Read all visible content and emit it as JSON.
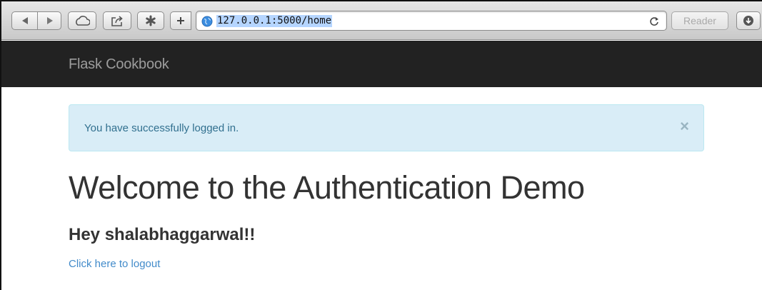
{
  "browser": {
    "url": "127.0.0.1:5000/home",
    "reader_label": "Reader",
    "icons": [
      "back-icon",
      "forward-icon",
      "cloud-icon",
      "share-icon",
      "bookmarks-icon",
      "new-tab-icon",
      "globe-icon",
      "reload-icon",
      "download-icon"
    ]
  },
  "navbar": {
    "brand": "Flask Cookbook",
    "background": "#222222"
  },
  "alert": {
    "message": "You have successfully logged in.",
    "close_label": "×",
    "background": "#d9edf7",
    "text_color": "#31708f"
  },
  "main": {
    "heading": "Welcome to the Authentication Demo",
    "greeting": "Hey shalabhaggarwal!!",
    "logout_link": "Click here to logout",
    "link_color": "#428bca"
  }
}
